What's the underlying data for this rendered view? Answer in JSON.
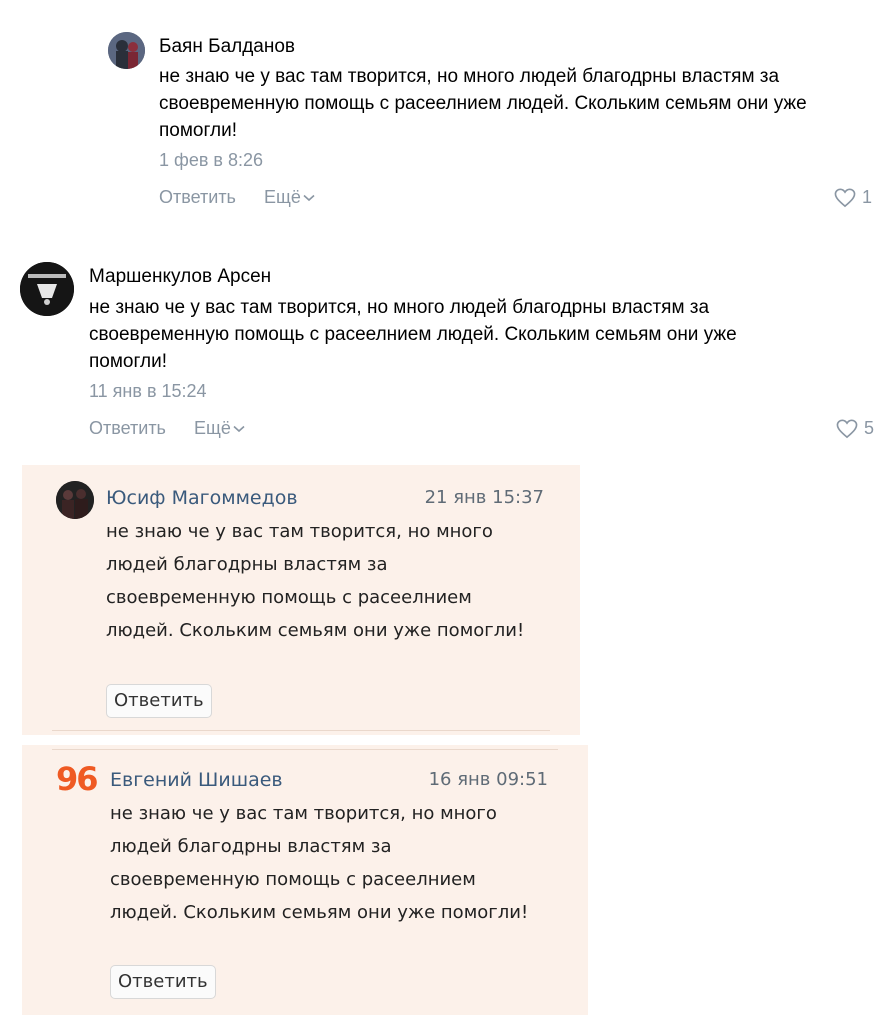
{
  "comments": [
    {
      "author": "Баян Балданов",
      "text": "не знаю че у вас там творится, но много людей благодрны властям за своевременную помощь с расеелнием людей. Скольким семьям они уже помогли!",
      "date": "1 фев в 8:26",
      "reply_label": "Ответить",
      "more_label": "Ещё",
      "likes": "1"
    },
    {
      "author": "Маршенкулов Арсен",
      "text": "не знаю че у вас там творится, но много людей благодрны властям за своевременную помощь с расеелнием людей. Скольким семьям они уже помогли!",
      "date": "11 янв в 15:24",
      "reply_label": "Ответить",
      "more_label": "Ещё",
      "likes": "5"
    }
  ],
  "cards": [
    {
      "author": "Юсиф Магоммедов",
      "time": "21 янв 15:37",
      "text": "не знаю че у вас там творится, но много людей благодрны властям за своевременную помощь с расеелнием людей. Скольким семьям они уже помогли!",
      "reply_label": "Ответить"
    },
    {
      "author": "Евгений Шишаев",
      "time": "16 янв 09:51",
      "text": "не знаю че у вас там творится, но много людей благодрны властям за своевременную помощь с расеелнием людей. Скольким семьям они уже помогли!",
      "reply_label": "Ответить",
      "avatar_logo": "96"
    }
  ],
  "colors": {
    "meta_gray": "#8a96a3",
    "card_bg": "#fcf1ea",
    "card_name": "#3a5a7c",
    "logo_orange": "#ef5a23"
  }
}
